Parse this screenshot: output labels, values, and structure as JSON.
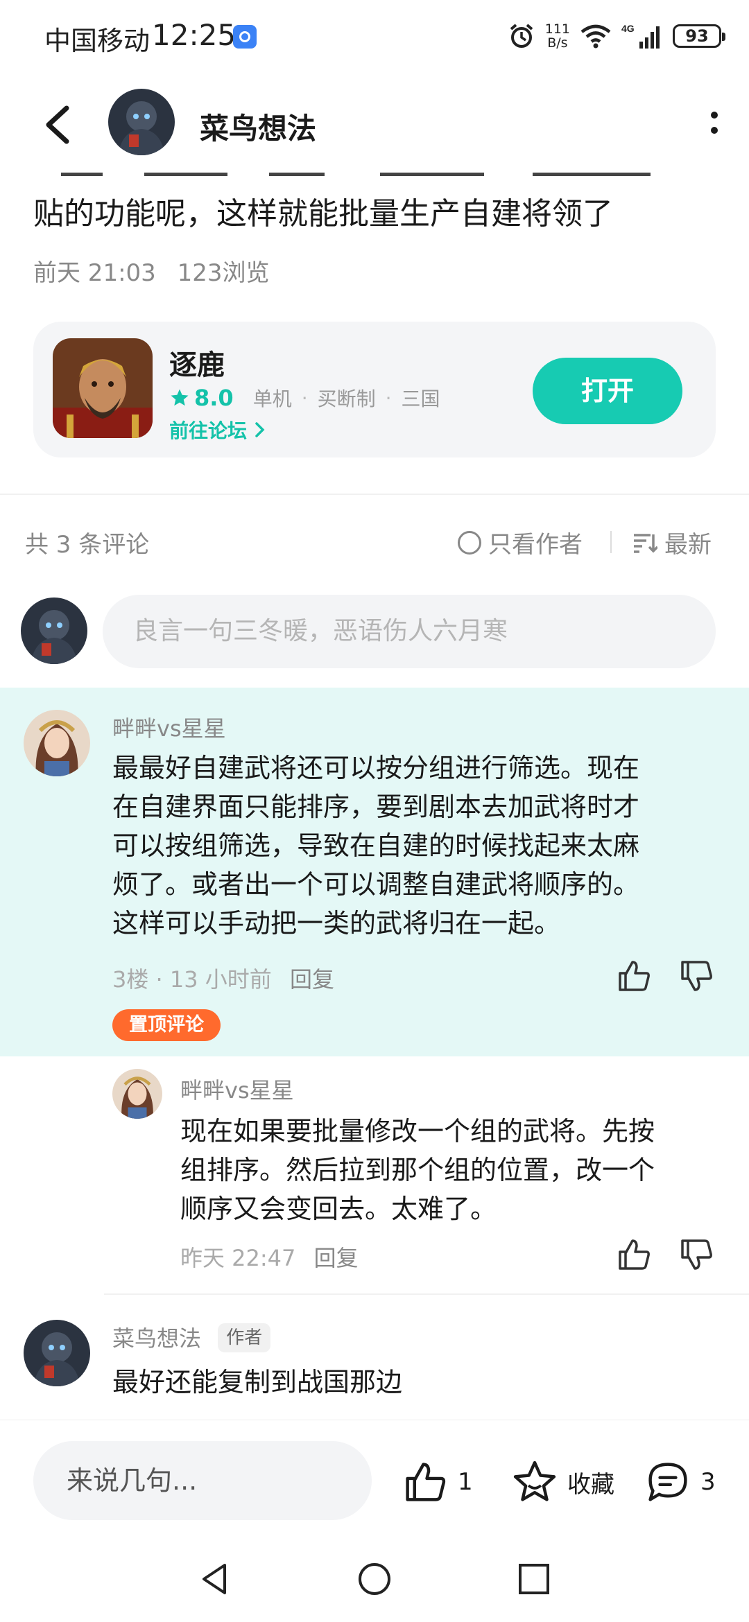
{
  "status_bar": {
    "carrier": "中国移动",
    "time": "12:25",
    "net_speed_value": "111",
    "net_speed_unit": "B/s",
    "network": "4G",
    "battery": "93"
  },
  "header": {
    "title": "菜鸟想法"
  },
  "post": {
    "text_tail": "贴的功能呢，这样就能批量生产自建将领了",
    "time": "前天 21:03",
    "views": "123浏览"
  },
  "game_card": {
    "name": "逐鹿",
    "rating": "8.0",
    "tags": [
      "单机",
      "买断制",
      "三国"
    ],
    "forum_link": "前往论坛",
    "open_label": "打开",
    "accent_color": "#17cbb2"
  },
  "comments_header": {
    "count_label": "共 3 条评论",
    "author_only": "只看作者",
    "sort": "最新"
  },
  "comment_input": {
    "placeholder": "良言一句三冬暖，恶语伤人六月寒"
  },
  "comments": [
    {
      "user": "畔畔vs星星",
      "lines": [
        "最最好自建武将还可以按分组进行筛选。现在",
        "在自建界面只能排序，要到剧本去加武将时才",
        "可以按组筛选，导致在自建的时候找起来太麻",
        "烦了。或者出一个可以调整自建武将顺序的。",
        "这样可以手动把一类的武将归在一起。"
      ],
      "floor": "3楼",
      "time": "13 小时前",
      "reply": "回复",
      "pinned_label": "置顶评论",
      "highlight_color": "#e4f8f6",
      "reply_item": {
        "user": "畔畔vs星星",
        "lines": [
          "现在如果要批量修改一个组的武将。先按",
          "组排序。然后拉到那个组的位置，改一个",
          "顺序又会变回去。太难了。"
        ],
        "time": "昨天 22:47",
        "reply": "回复"
      }
    },
    {
      "user": "菜鸟想法",
      "author_badge": "作者",
      "text": "最好还能复制到战国那边"
    }
  ],
  "bottom_bar": {
    "say_placeholder": "来说几句...",
    "likes": "1",
    "favorite": "收藏",
    "comments": "3"
  }
}
